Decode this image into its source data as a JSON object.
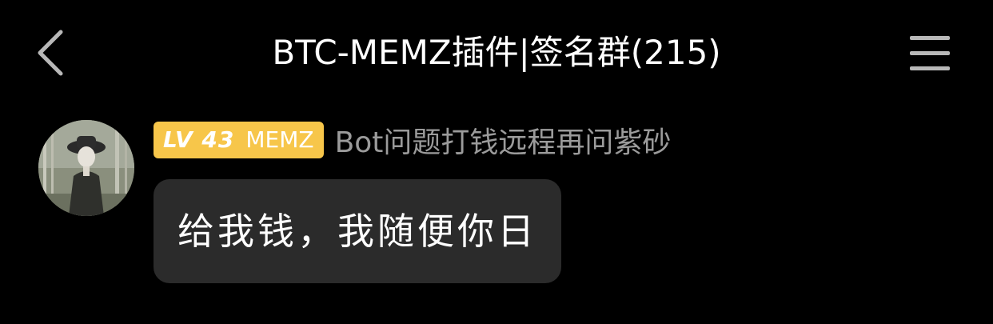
{
  "nav": {
    "title": "BTC-MEMZ插件|签名群(215)",
    "back_icon": "chevron-left-icon",
    "menu_icon": "hamburger-menu-icon"
  },
  "message": {
    "avatar_icon": "avatar-image",
    "badge": {
      "level": "LV 43",
      "name": "MEMZ",
      "color": "#f7c64a"
    },
    "sender_name": "Bot问题打钱远程再问紫砂",
    "text": "给我钱，我随便你日"
  },
  "colors": {
    "background": "#000000",
    "bubble": "#2b2b2b",
    "sender_name": "#9b9b9b",
    "title": "#ffffff"
  }
}
